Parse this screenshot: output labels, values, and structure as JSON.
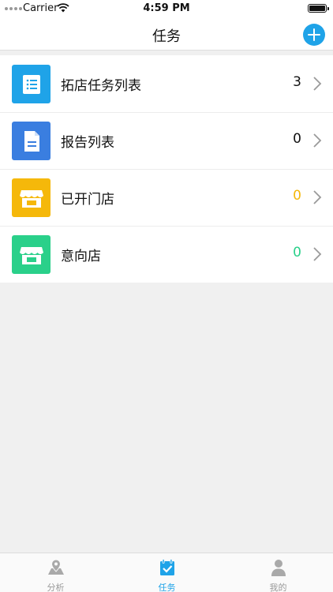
{
  "status_bar": {
    "carrier": "Carrier",
    "time": "4:59 PM"
  },
  "nav": {
    "title": "任务",
    "add_icon": "plus-circle-icon"
  },
  "rows": [
    {
      "label": "拓店任务列表",
      "count": "3",
      "icon": "list-document-icon",
      "tile_color": "#1fa3e8",
      "count_color": "#111111"
    },
    {
      "label": "报告列表",
      "count": "0",
      "icon": "report-file-icon",
      "tile_color": "#3a7ee0",
      "count_color": "#111111"
    },
    {
      "label": "已开门店",
      "count": "0",
      "icon": "storefront-icon",
      "tile_color": "#f5b80a",
      "count_color": "#f5b80a"
    },
    {
      "label": "意向店",
      "count": "0",
      "icon": "storefront-icon",
      "tile_color": "#2ad08a",
      "count_color": "#2ad08a"
    }
  ],
  "tabs": [
    {
      "label": "分析",
      "icon": "map-pin-icon",
      "active": false
    },
    {
      "label": "任务",
      "icon": "calendar-check-icon",
      "active": true
    },
    {
      "label": "我的",
      "icon": "user-profile-icon",
      "active": false
    }
  ],
  "colors": {
    "accent": "#1fa3e8",
    "inactive": "#999999"
  }
}
